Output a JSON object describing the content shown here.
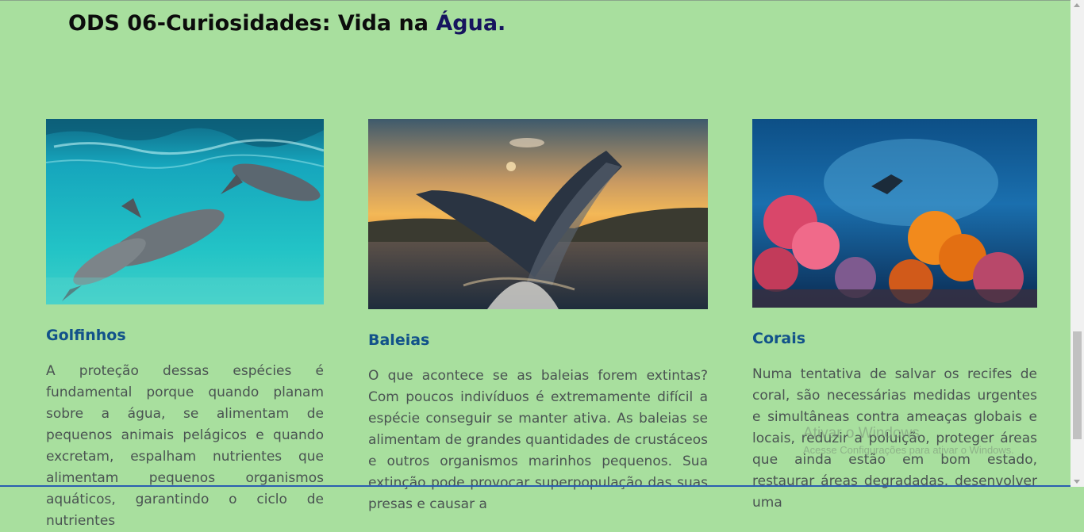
{
  "page": {
    "title_main": "ODS 06-Curiosidades: Vida na ",
    "title_accent": "Água."
  },
  "cards": [
    {
      "image": "dolphins-photo",
      "heading": "Golfinhos",
      "text": "A proteção dessas espécies é fundamental porque quando planam sobre a água, se alimentam de pequenos animais pelágicos e quando excretam, espalham nutrientes que alimentam pequenos organismos aquáticos, garantindo o ciclo de nutrientes"
    },
    {
      "image": "whale-photo",
      "heading": "Baleias",
      "text": "O que acontece se as baleias forem extintas? Com poucos indivíduos é extremamente difícil a espécie conseguir se manter ativa. As baleias se alimentam de grandes quantidades de crustáceos e outros organismos marinhos pequenos. Sua extinção pode provocar superpopulação das suas presas e causar a"
    },
    {
      "image": "coral-reef-photo",
      "heading": "Corais",
      "text": "Numa tentativa de salvar os recifes de coral, são necessárias medidas urgentes e simultâneas contra ameaças globais e locais, reduzir a poluição, proteger áreas que ainda estão em bom estado, restaurar áreas degradadas, desenvolver uma"
    }
  ],
  "watermark": {
    "line1": "Ativar o Windows",
    "line2": "Acesse Configurações para ativar o Windows."
  },
  "colors": {
    "background": "#a8df9e",
    "heading": "#12528a",
    "title_accent": "#16145e"
  }
}
